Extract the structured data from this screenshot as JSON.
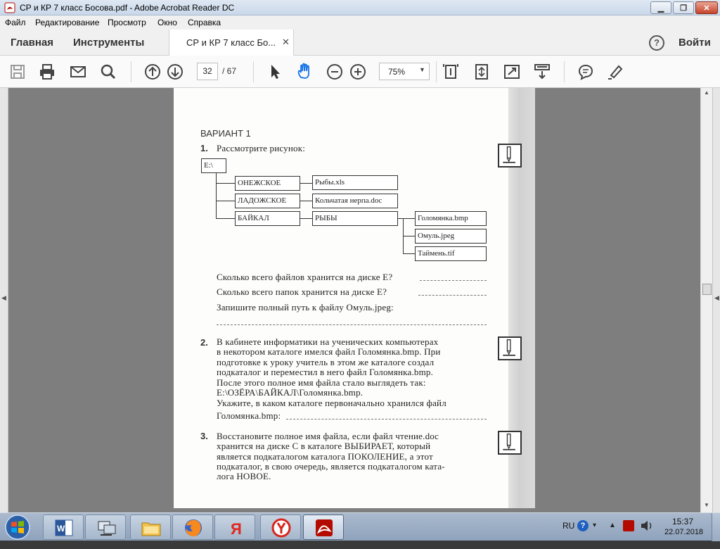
{
  "window": {
    "title": "СР и КР 7 класс Босова.pdf - Adobe Acrobat Reader DC",
    "min_glyph": "▁",
    "max_glyph": "❐",
    "close_glyph": "✕"
  },
  "menu": [
    "Файл",
    "Редактирование",
    "Просмотр",
    "Окно",
    "Справка"
  ],
  "tabs": {
    "home": "Главная",
    "tools": "Инструменты",
    "document": "СР и КР 7 класс Бо...",
    "close_glyph": "✕",
    "help_glyph": "?",
    "login": "Войти"
  },
  "toolbar": {
    "icons": [
      "save-icon",
      "print-icon",
      "email-icon",
      "search-icon",
      "page-up-icon",
      "page-down-icon",
      "select-cursor-icon",
      "hand-tool-icon",
      "zoom-out-icon",
      "zoom-in-icon",
      "fit-page-icon",
      "scrolling-mode-icon",
      "full-screen-icon",
      "read-mode-icon",
      "comment-icon",
      "highlight-icon"
    ],
    "page_current": "32",
    "page_total": "/ 67",
    "zoom_value": "75%",
    "zoom_caret": "▼"
  },
  "sidepanels": {
    "left_arrow": "◀",
    "right_arrow": "◀"
  },
  "scrollbar": {
    "up": "▲",
    "down": "▼",
    "position_fraction": 0.47
  },
  "page": {
    "variant": "ВАРИАНТ  1",
    "q1": {
      "num": "1.",
      "text": "Рассмотрите рисунок:",
      "tree": {
        "root": "Е:\\",
        "folders": [
          "ОНЕЖСКОЕ",
          "ЛАДОЖСКОЕ",
          "БАЙКАЛ"
        ],
        "files": [
          "Рыбы.xls",
          "Кольчатая нерпа.doc"
        ],
        "subfolder": "РЫБЫ",
        "subfiles": [
          "Голомянка.bmp",
          "Омуль.jpeg",
          "Таймень.tif"
        ]
      },
      "lines": [
        "Сколько всего файлов хранится на диске Е?",
        "Сколько всего папок хранится на диске Е?",
        "Запишите полный путь к файлу Омуль.jpeg:"
      ]
    },
    "q2": {
      "num": "2.",
      "lines": [
        "В  кабинете  информатики  на  ученических  компьютерах",
        "в некотором каталоге имелся файл Голомянка.bmp. При",
        "подготовке  к  уроку  учитель  в  этом  же  каталоге  создал",
        "подкаталог  и  переместил  в  него  файл  Голомянка.bmp.",
        "После  этого  полное  имя  файла  стало  выглядеть  так:",
        "Е:\\ОЗЁРА\\БАЙКАЛ\\Голомянка.bmp.",
        "Укажите, в каком каталоге первоначально хранился файл",
        "Голомянка.bmp:"
      ]
    },
    "q3": {
      "num": "3.",
      "lines": [
        "Восстановите полное имя файла, если файл  чтение.doc",
        "хранится  на  диске  С  в  каталоге  ВЫБИРАЕТ,  который",
        "является  подкаталогом  каталога  ПОКОЛЕНИЕ,  а  этот",
        "подкаталог,  в  свою  очередь,  является  подкаталогом  ката-",
        "лога НОВОЕ."
      ]
    }
  },
  "taskbar": {
    "apps": [
      "word-icon",
      "network-icon",
      "explorer-icon",
      "firefox-icon",
      "yandex-icon",
      "yandex-browser-icon",
      "acrobat-icon"
    ],
    "lang": "RU",
    "time": "15:37",
    "date": "22.07.2018"
  }
}
